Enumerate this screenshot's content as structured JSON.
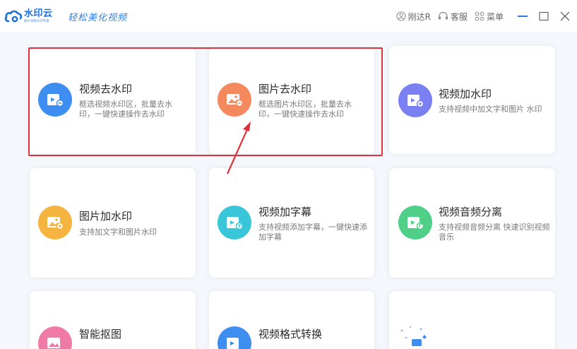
{
  "app": {
    "logo_name": "水印云",
    "logo_sub": "图片视频水印专家",
    "slogan": "轻松美化视频"
  },
  "header": {
    "user_label": "刚达R",
    "service_label": "客服",
    "menu_label": "菜单"
  },
  "tools": [
    {
      "title": "视频去水印",
      "desc": "框选视频水印区，批量去水印，一键快速操作去水印",
      "color": "#3d8ef0",
      "icon": "video-icon"
    },
    {
      "title": "图片去水印",
      "desc": "框选图片水印区，批量去水印，一键快速操作去水印",
      "color": "#f5895e",
      "icon": "image-icon"
    },
    {
      "title": "视频加水印",
      "desc": "支持视频中加文字和图片 水印",
      "color": "#7a7ff2",
      "icon": "video-icon"
    },
    {
      "title": "图片加水印",
      "desc": "支持加文字和图片水印",
      "color": "#f5b340",
      "icon": "image-icon"
    },
    {
      "title": "视频加字幕",
      "desc": "支持视频添加字幕，一键快速添加字幕",
      "color": "#38c6d8",
      "icon": "video-icon"
    },
    {
      "title": "视频音频分离",
      "desc": "支持视频音频分离 快速识别视频音乐",
      "color": "#4fcf87",
      "icon": "video-icon"
    },
    {
      "title": "智能抠图",
      "desc": "",
      "color": "#f07aa6",
      "icon": "image-icon"
    },
    {
      "title": "视频格式转换",
      "desc": "",
      "color": "#3d8ef0",
      "icon": "video-icon"
    },
    {
      "title": "",
      "desc": "",
      "color": "#3d8ef0",
      "icon": "sparkle-icon"
    }
  ]
}
